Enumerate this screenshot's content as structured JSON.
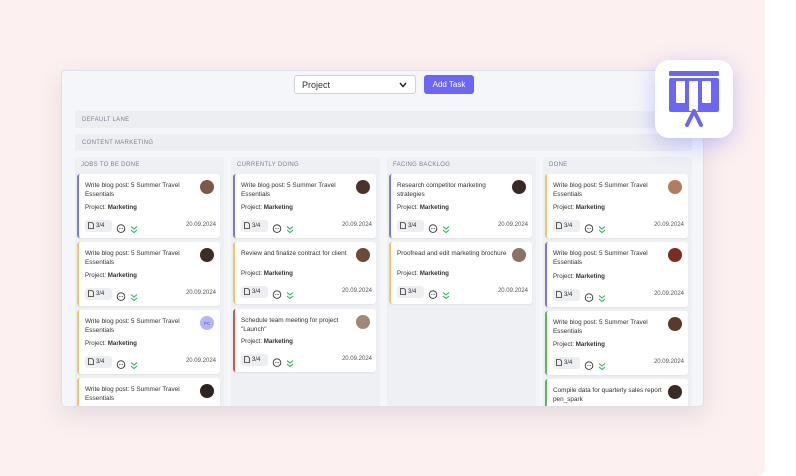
{
  "toolbar": {
    "project_select": "Project",
    "add_task_label": "Add Task"
  },
  "lanes": {
    "default": "DEFAULT LANE",
    "content_marketing": "CONTENT MARKETING"
  },
  "colors": {
    "accent": "#6b66f6",
    "card_border_blue": "#7a76e8",
    "card_border_yellow": "#f1c869",
    "card_border_red": "#d9534f",
    "card_border_green": "#5cb85c",
    "priority_green": "#34b35a"
  },
  "columns": [
    {
      "title": "JOBS TO BE DONE",
      "cards": [
        {
          "title": "Write blog post: 5 Summer Travel Essentials",
          "project_label": "Project:",
          "project": "Marketing",
          "subtasks": "3/4",
          "date": "20.09.2024",
          "avatar": ""
        },
        {
          "title": "Write blog post: 5 Summer Travel Essentials",
          "project_label": "Project:",
          "project": "Marketing",
          "subtasks": "3/4",
          "date": "20.09.2024",
          "avatar": ""
        },
        {
          "title": "Write blog post: 5 Summer Travel Essentials",
          "project_label": "Project:",
          "project": "Marketing",
          "subtasks": "3/4",
          "date": "20.09.2024",
          "avatar": "PC"
        },
        {
          "title": "Write blog post: 5 Summer Travel Essentials",
          "project_label": "",
          "project": "",
          "subtasks": "",
          "date": "",
          "avatar": ""
        }
      ]
    },
    {
      "title": "CURRENTLY DOING",
      "cards": [
        {
          "title": "Write blog post: 5 Summer Travel Essentials",
          "project_label": "Project:",
          "project": "Marketing",
          "subtasks": "3/4",
          "date": "20.09.2024",
          "avatar": ""
        },
        {
          "title": "Review and finalize contract for client",
          "project_label": "Project:",
          "project": "Marketing",
          "subtasks": "3/4",
          "date": "20.09.2024",
          "avatar": ""
        },
        {
          "title": "Schedule team meeting for project \"Launch\"",
          "project_label": "Project:",
          "project": "Marketing",
          "subtasks": "3/4",
          "date": "20.09.2024",
          "avatar": ""
        }
      ]
    },
    {
      "title": "FACING BACKLOG",
      "cards": [
        {
          "title": "Research competitor marketing strategies",
          "project_label": "Project:",
          "project": "Marketing",
          "subtasks": "3/4",
          "date": "20.09.2024",
          "avatar": ""
        },
        {
          "title": "Proofread and edit marketing brochure",
          "project_label": "Project:",
          "project": "Marketing",
          "subtasks": "3/4",
          "date": "20.09.2024",
          "avatar": ""
        }
      ]
    },
    {
      "title": "DONE",
      "cards": [
        {
          "title": "Write blog post: 5 Summer Travel Essentials",
          "project_label": "Project:",
          "project": "Marketing",
          "subtasks": "3/4",
          "date": "20.09.2024",
          "avatar": ""
        },
        {
          "title": "Write blog post: 5 Summer Travel Essentials",
          "project_label": "Project:",
          "project": "Marketing",
          "subtasks": "3/4",
          "date": "20.09.2024",
          "avatar": ""
        },
        {
          "title": "Write blog post: 5 Summer Travel Essentials",
          "project_label": "Project:",
          "project": "Marketing",
          "subtasks": "3/4",
          "date": "20.09.2024",
          "avatar": ""
        },
        {
          "title": "Compile data for quarterly sales report pen_spark",
          "project_label": "",
          "project": "",
          "subtasks": "",
          "date": "",
          "avatar": ""
        }
      ]
    }
  ]
}
